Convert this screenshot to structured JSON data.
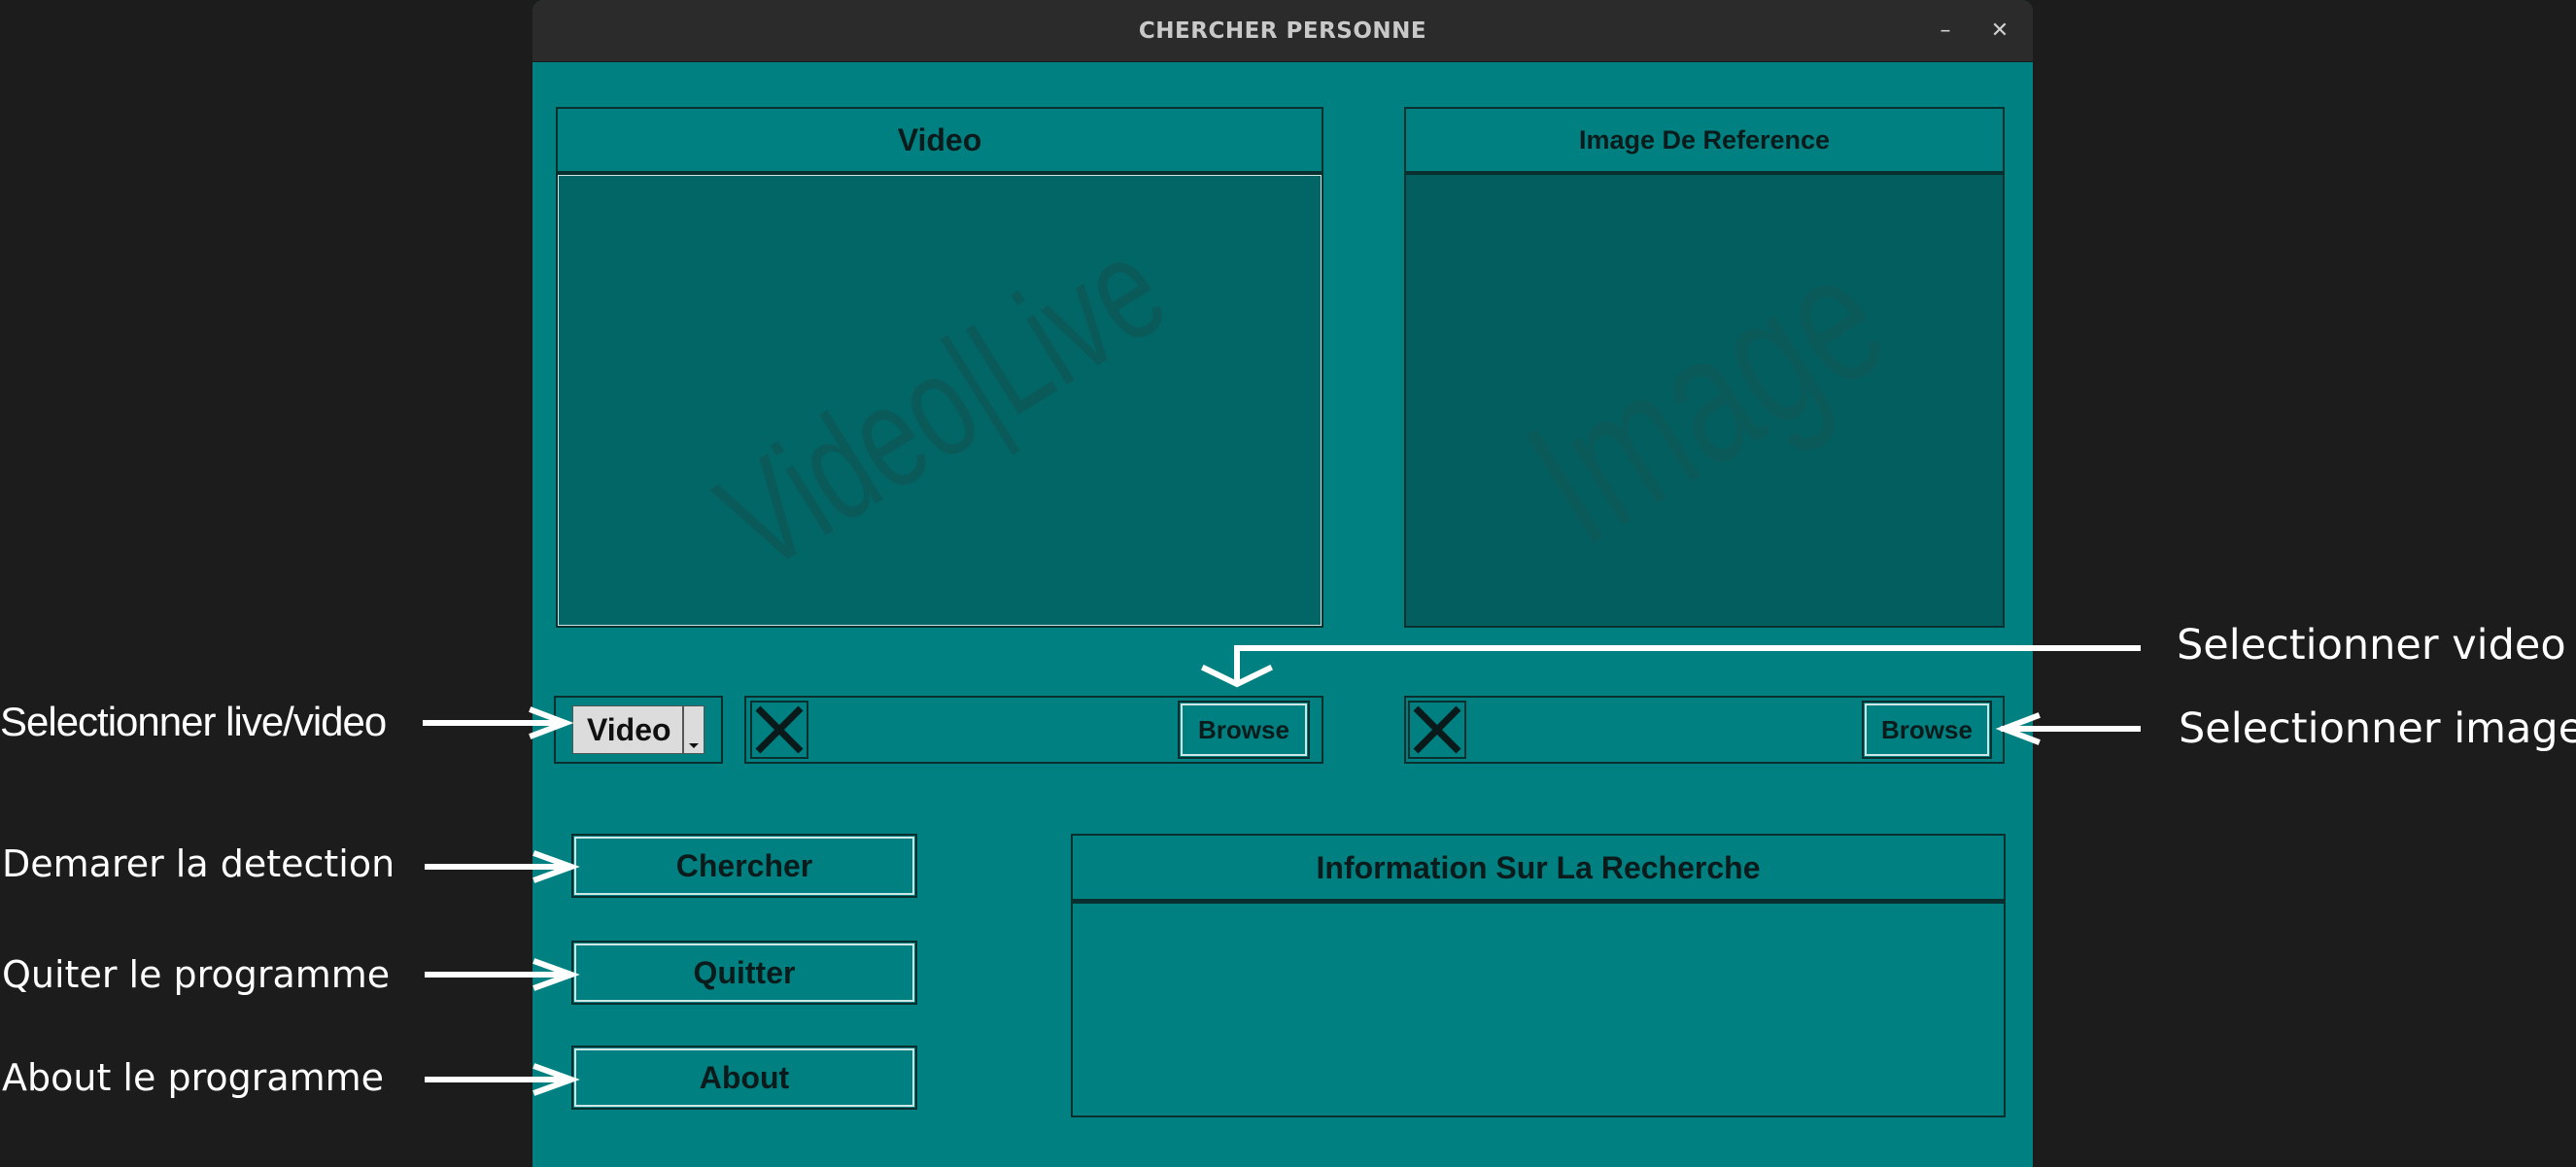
{
  "window": {
    "title": "CHERCHER PERSONNE",
    "minimize_glyph": "–",
    "close_glyph": "✕"
  },
  "video_panel": {
    "header": "Video",
    "watermark": "Video|Live"
  },
  "image_panel": {
    "header": "Image De Reference",
    "watermark": "Image"
  },
  "source_select": {
    "selected": "Video"
  },
  "video_browse": {
    "button_label": "Browse",
    "status_icon": "x-icon"
  },
  "image_browse": {
    "button_label": "Browse",
    "status_icon": "x-icon"
  },
  "actions": {
    "search_label": "Chercher",
    "quit_label": "Quitter",
    "about_label": "About"
  },
  "info_panel": {
    "header": "Information Sur La Recherche",
    "content": ""
  },
  "annotations": {
    "select_source": "Selectionner live/video",
    "start_detection": "Demarer la detection",
    "quit_program": "Quiter le programme",
    "about_program": "About le programme",
    "select_video": "Selectionner video",
    "select_image": "Selectionner image"
  },
  "colors": {
    "window_bg": "#008080",
    "display_bg": "#036666",
    "titlebar_bg": "#2b2b2b",
    "page_bg": "#1c1c1c",
    "annotation": "#ffffff"
  }
}
